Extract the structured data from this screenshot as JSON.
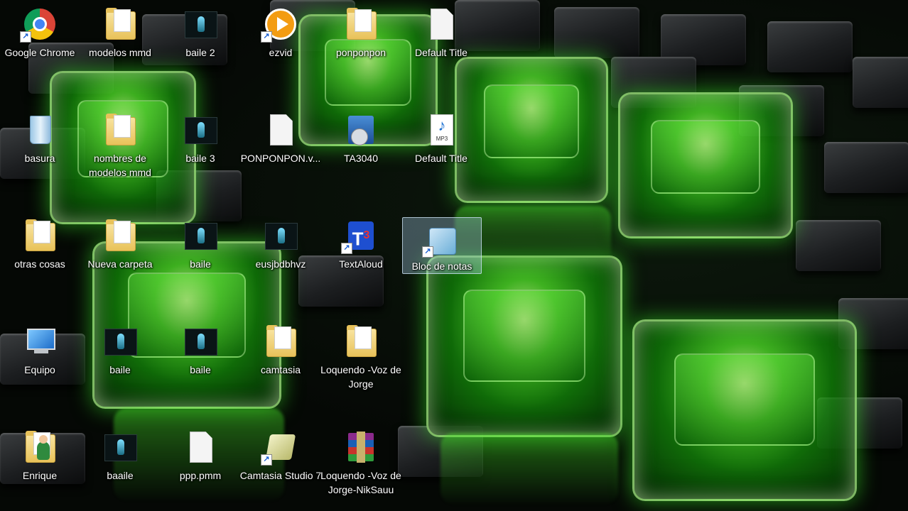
{
  "desktop": {
    "icons": [
      {
        "label": "Google Chrome",
        "icon": "chrome-icon",
        "shortcut": true
      },
      {
        "label": "modelos mmd",
        "icon": "folder-icon",
        "shortcut": false
      },
      {
        "label": "baile 2",
        "icon": "video-file-icon",
        "shortcut": false
      },
      {
        "label": "ezvid",
        "icon": "ezvid-icon",
        "shortcut": true
      },
      {
        "label": "ponponpon",
        "icon": "folder-icon",
        "shortcut": false
      },
      {
        "label": "Default Title",
        "icon": "document-icon",
        "shortcut": false
      },
      {
        "label": "basura",
        "icon": "recycle-bin-icon",
        "shortcut": false
      },
      {
        "label": "nombres de modelos mmd",
        "icon": "folder-icon",
        "shortcut": false
      },
      {
        "label": "baile 3",
        "icon": "video-file-icon",
        "shortcut": false
      },
      {
        "label": "PONPONPON.v...",
        "icon": "document-icon",
        "shortcut": false
      },
      {
        "label": "TA3040",
        "icon": "installer-icon",
        "shortcut": false
      },
      {
        "label": "Default Title",
        "icon": "mp3-file-icon",
        "shortcut": false
      },
      {
        "label": "otras cosas",
        "icon": "folder-icon",
        "shortcut": false
      },
      {
        "label": "Nueva carpeta",
        "icon": "folder-icon",
        "shortcut": false
      },
      {
        "label": "baile",
        "icon": "video-file-icon",
        "shortcut": false
      },
      {
        "label": "eusjbdbhvz",
        "icon": "video-file-icon",
        "shortcut": false
      },
      {
        "label": "TextAloud",
        "icon": "textaloud-icon",
        "shortcut": true
      },
      {
        "label": "Bloc de notas",
        "icon": "notepad-icon",
        "shortcut": true,
        "selected": true
      },
      {
        "label": "Equipo",
        "icon": "computer-icon",
        "shortcut": false
      },
      {
        "label": "baile",
        "icon": "video-file-icon",
        "shortcut": false
      },
      {
        "label": "baile",
        "icon": "video-file-icon",
        "shortcut": false
      },
      {
        "label": "camtasia",
        "icon": "folder-icon",
        "shortcut": false
      },
      {
        "label": "Loquendo -Voz de Jorge",
        "icon": "folder-icon",
        "shortcut": false
      },
      {
        "label": "Enrique",
        "icon": "user-folder-icon",
        "shortcut": false
      },
      {
        "label": "baaile",
        "icon": "video-file-icon",
        "shortcut": false
      },
      {
        "label": "ppp.pmm",
        "icon": "document-icon",
        "shortcut": false
      },
      {
        "label": "Camtasia Studio 7",
        "icon": "camtasia-icon",
        "shortcut": true
      },
      {
        "label": "Loquendo -Voz de Jorge-NikSauu",
        "icon": "winrar-archive-icon",
        "shortcut": false
      }
    ]
  },
  "mp3_badge": "MP3",
  "t3_badge": "T",
  "t3_badge_sup": "3"
}
